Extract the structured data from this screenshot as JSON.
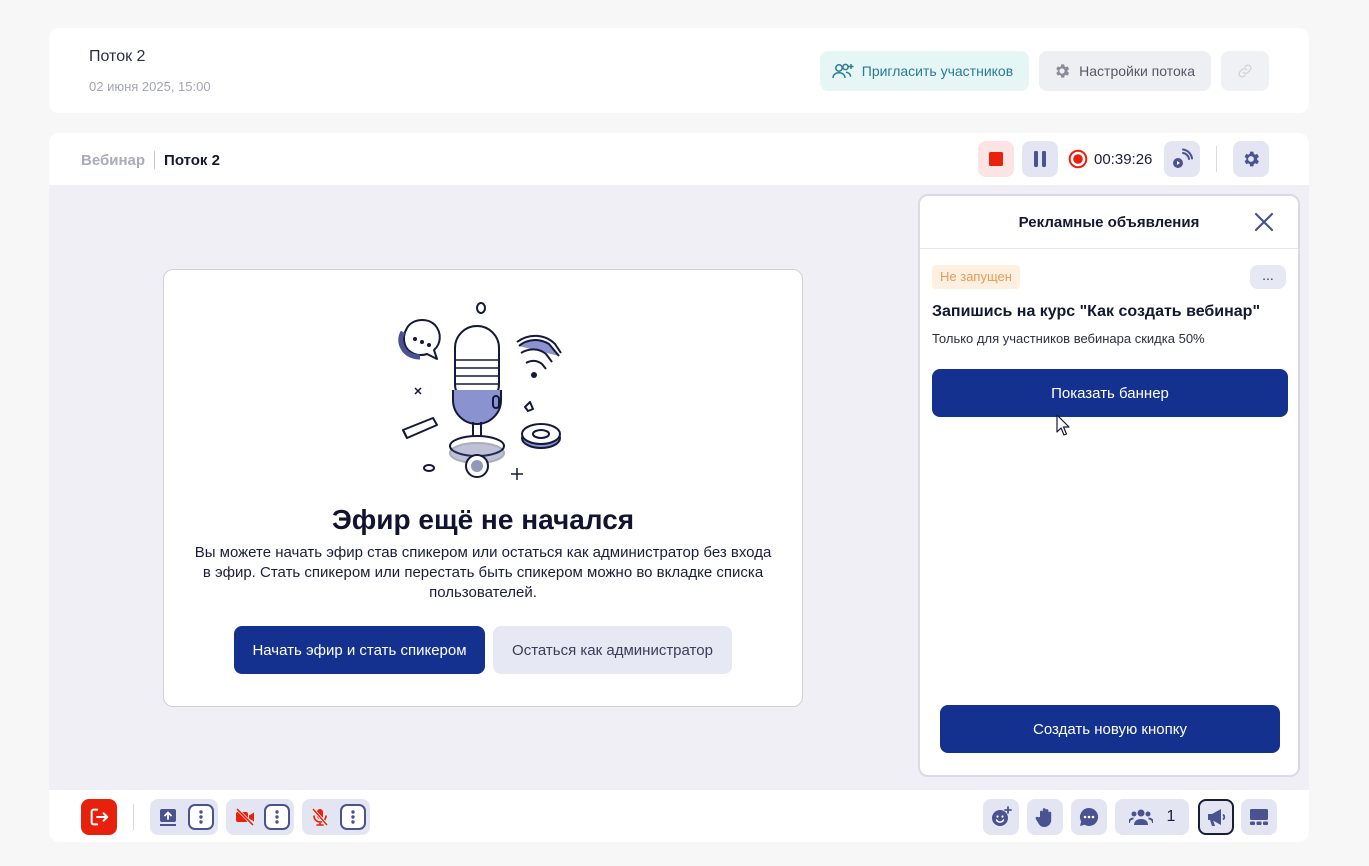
{
  "stream": {
    "title": "Поток 2",
    "date": "02 июня 2025, 15:00"
  },
  "top_actions": {
    "invite_label": "Пригласить участников",
    "settings_label": "Настройки потока"
  },
  "breadcrumb": {
    "parent": "Вебинар",
    "current": "Поток 2"
  },
  "controls": {
    "timer": "00:39:26"
  },
  "center": {
    "title": "Эфир ещё не начался",
    "description": "Вы можете начать эфир став спикером или остаться как администратор без входа в эфир. Стать спикером или перестать быть спикером можно во вкладке списка пользователей.",
    "start_label": "Начать эфир и стать спикером",
    "admin_label": "Остаться как администратор"
  },
  "ads_panel": {
    "title": "Рекламные объявления",
    "status_badge": "Не запущен",
    "more_label": "...",
    "ad_heading": "Запишись на курс \"Как создать вебинар\"",
    "ad_subtext": "Только для участников вебинара скидка 50%",
    "show_banner_label": "Показать баннер",
    "create_button_label": "Создать новую кнопку"
  },
  "bottom_bar": {
    "users_count": "1"
  },
  "colors": {
    "primary": "#14318f",
    "danger": "#e8210d",
    "accent_icon": "#4a5290"
  },
  "icons": [
    "add-user-icon",
    "gear-icon",
    "link-icon",
    "stop-icon",
    "pause-icon",
    "record-icon",
    "broadcast-icon",
    "close-icon",
    "exit-icon",
    "screen-share-icon",
    "camera-off-icon",
    "mic-off-icon",
    "emoji-icon",
    "raise-hand-icon",
    "chat-icon",
    "users-icon",
    "megaphone-icon",
    "layout-icon"
  ]
}
